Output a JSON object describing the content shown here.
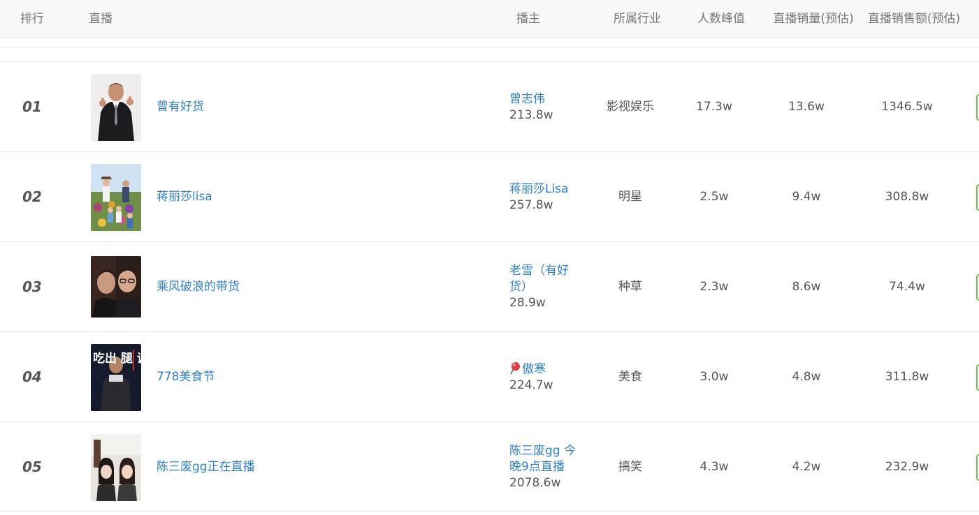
{
  "header": {
    "rank": "排行",
    "live": "直播",
    "streamer": "播主",
    "industry": "所属行业",
    "peak": "人数峰值",
    "sales": "直播销量(预估)",
    "revenue": "直播销售额(预估)"
  },
  "rows": [
    {
      "rank": "01",
      "title": "曾有好货",
      "streamer_name": "曾志伟",
      "streamer_fans": "213.8w",
      "industry": "影视娱乐",
      "peak": "17.3w",
      "sales": "13.6w",
      "revenue": "1346.5w",
      "thumb_desc": "man-in-suit-thumbs-up"
    },
    {
      "rank": "02",
      "title": "蒋丽莎lisa",
      "streamer_name": "蒋丽莎Lisa",
      "streamer_fans": "257.8w",
      "industry": "明星",
      "peak": "2.5w",
      "sales": "9.4w",
      "revenue": "308.8w",
      "thumb_desc": "family-in-flower-field"
    },
    {
      "rank": "03",
      "title": "乘风破浪的带货",
      "streamer_name": "老雪（有好货）",
      "streamer_fans": "28.9w",
      "industry": "种草",
      "peak": "2.3w",
      "sales": "8.6w",
      "revenue": "74.4w",
      "thumb_desc": "two-men-selfie"
    },
    {
      "rank": "04",
      "title": "778美食节",
      "streamer_name": "傲寒",
      "streamer_fans": "224.7w",
      "industry": "美食",
      "peak": "3.0w",
      "sales": "4.8w",
      "revenue": "311.8w",
      "thumb_desc": "man-with-calligraphy-poster",
      "name_icon": "pushpin-icon"
    },
    {
      "rank": "05",
      "title": "陈三废gg正在直播",
      "streamer_name": "陈三废gg 今晚9点直播",
      "streamer_fans": "2078.6w",
      "industry": "搞笑",
      "peak": "4.3w",
      "sales": "4.2w",
      "revenue": "232.9w",
      "thumb_desc": "two-women-indoors"
    }
  ],
  "poster_text": "吃出 腿 调",
  "colors": {
    "link": "#2f80d1",
    "text": "#555555",
    "header_bg": "#f8f8f8",
    "action_border": "#6cc24a"
  }
}
